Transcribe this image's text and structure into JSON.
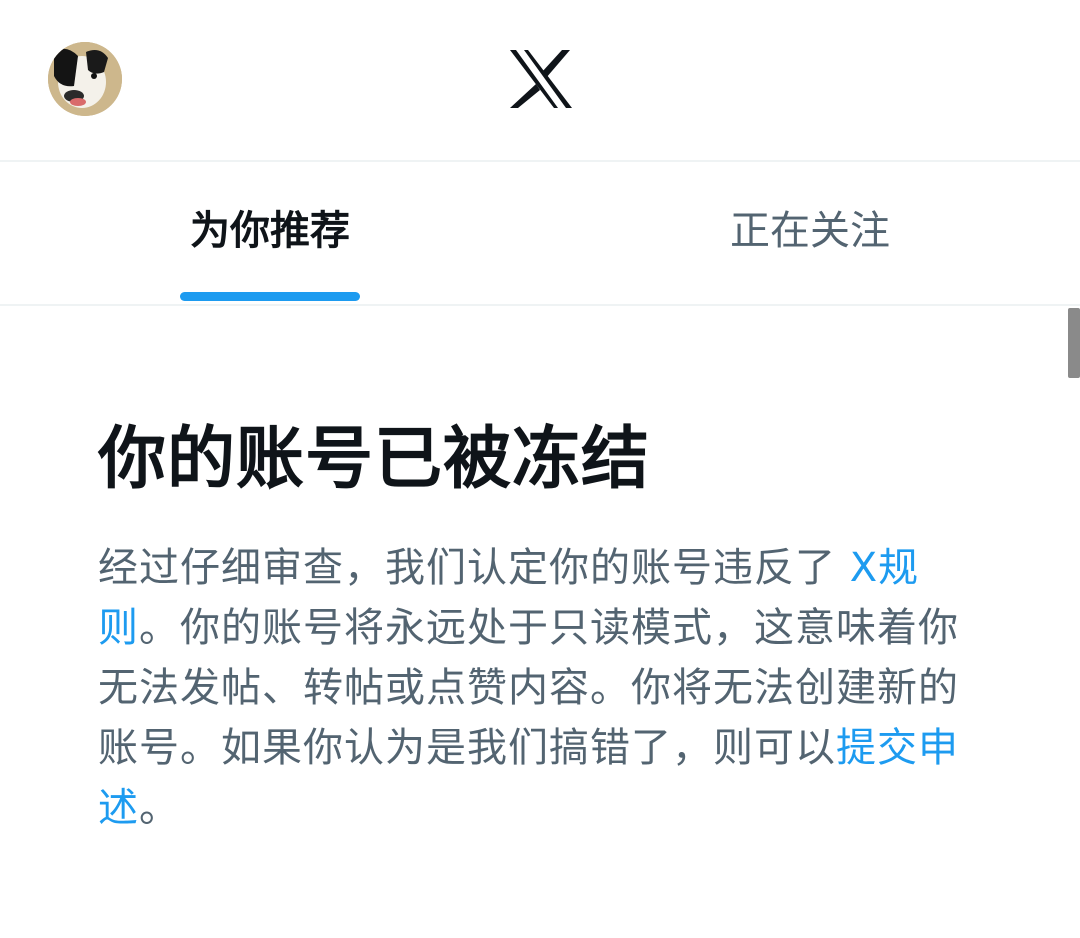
{
  "header": {
    "avatar_icon": "dog-avatar-icon",
    "logo_icon": "x-logo-icon"
  },
  "tabs": [
    {
      "label": "为你推荐",
      "active": true
    },
    {
      "label": "正在关注",
      "active": false
    }
  ],
  "notice": {
    "title": "你的账号已被冻结",
    "text_1": "经过仔细审查，我们认定你的账号违反了 ",
    "link_rules": "X规则",
    "text_2": "。你的账号将永远处于只读模式，这意味着你无法发帖、转帖或点赞内容。你将无法创建新的账号。如果你认为是我们搞错了，则可以",
    "link_appeal": "提交申述",
    "text_3": "。"
  },
  "colors": {
    "accent": "#1d9bf0",
    "primary_text": "#0f1419",
    "secondary_text": "#536471",
    "divider": "#eff3f4"
  }
}
